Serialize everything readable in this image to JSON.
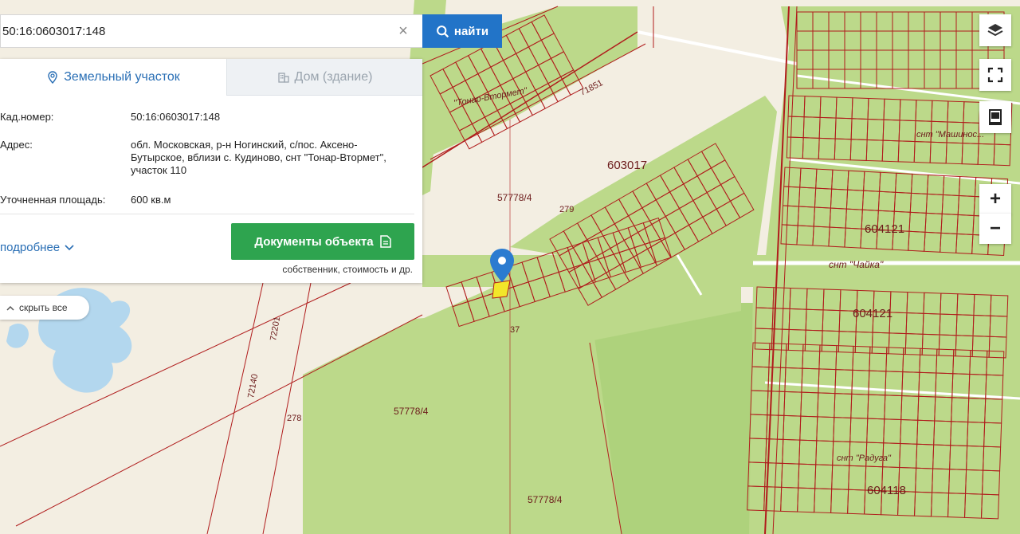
{
  "search": {
    "value": "50:16:0603017:148",
    "button_label": "найти"
  },
  "tabs": [
    {
      "label": "Земельный участок",
      "active": true
    },
    {
      "label": "Дом (здание)",
      "active": false
    }
  ],
  "info": {
    "cad_label": "Кад.номер:",
    "cad_value": "50:16:0603017:148",
    "address_label": "Адрес:",
    "address_value": "обл. Московская, р-н Ногинский, с/пос. Аксено-Бутырское, вблизи с. Кудиново, снт \"Тонар-Втормет\", участок 110",
    "area_label": "Уточненная площадь:",
    "area_value": "600 кв.м"
  },
  "actions": {
    "more_label": "подробнее",
    "docs_label": "Документы объекта",
    "docs_hint": "собственник, стоимость и др.",
    "hide_all_label": "скрыть все"
  },
  "map": {
    "quarter_labels": [
      "603017",
      "604121",
      "604121",
      "604118"
    ],
    "parcel_labels": [
      "57778/4",
      "57778/4",
      "57778/4",
      "279",
      "278",
      "72201",
      "72140",
      "71851",
      "37"
    ],
    "snt_labels": [
      "снт \"Чайка\"",
      "снт \"Машинос...\"",
      "\"Тонар-Втормет\"",
      "снт \"Радуга\""
    ],
    "colors": {
      "background": "#f3eee2",
      "green": "#bcd98a",
      "dark_green": "#a9cd74",
      "parcel_border": "#b01c1c",
      "water": "#b3d7ee",
      "marker": "#2b7bd0",
      "selected": "#f3e62a"
    }
  },
  "controls": [
    "layers-icon",
    "fullscreen-icon",
    "print-icon",
    "zoom-in",
    "zoom-out"
  ],
  "zoom_in_label": "+",
  "zoom_out_label": "−"
}
